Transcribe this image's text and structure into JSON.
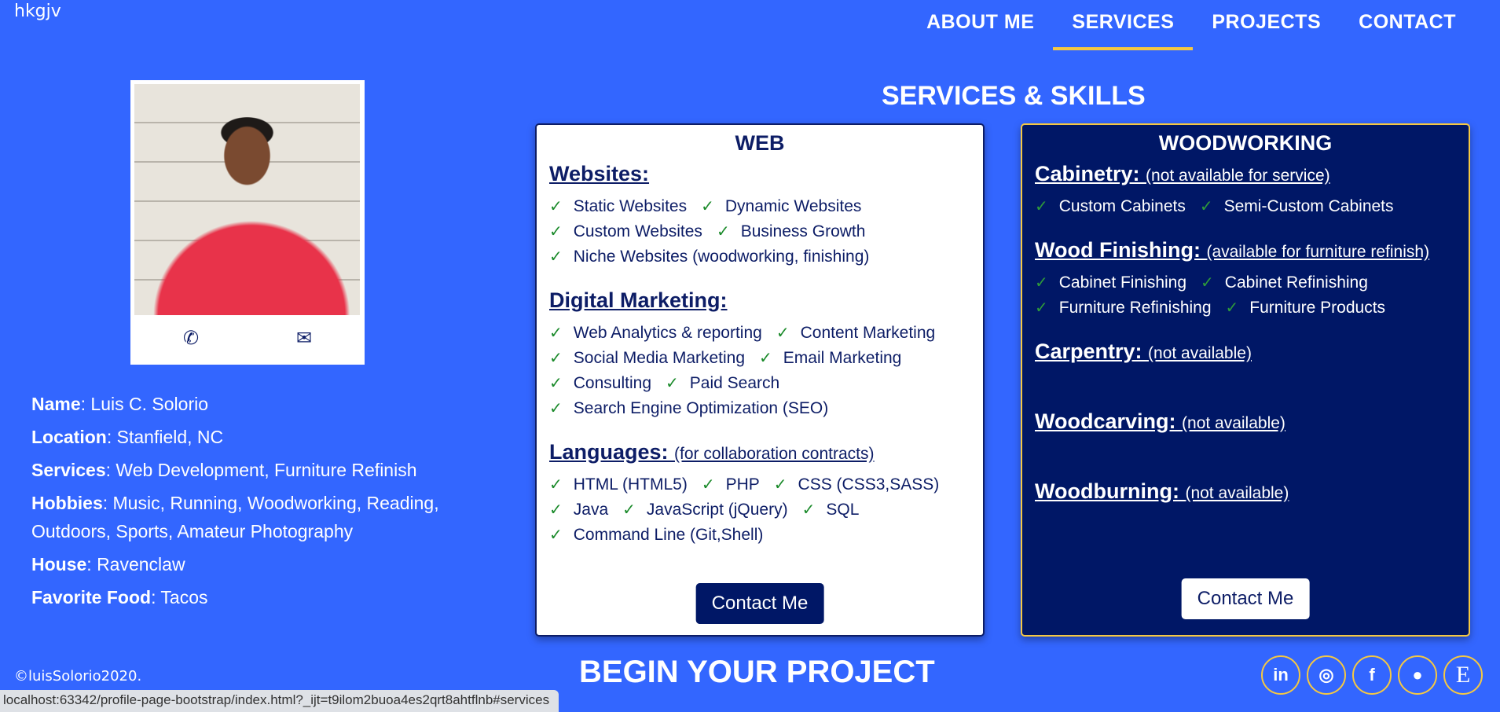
{
  "brand": "hkgjv",
  "nav": [
    {
      "label": "ABOUT ME",
      "active": false
    },
    {
      "label": "SERVICES",
      "active": true
    },
    {
      "label": "PROJECTS",
      "active": false
    },
    {
      "label": "CONTACT",
      "active": false
    }
  ],
  "profile": {
    "photo_alt": "Portrait of Luis C. Solorio",
    "icons": [
      "phone-icon",
      "envelope-icon"
    ],
    "info": [
      {
        "label": "Name",
        "value": ": Luis C. Solorio"
      },
      {
        "label": "Location",
        "value": ": Stanfield, NC"
      },
      {
        "label": "Services",
        "value": ": Web Development, Furniture Refinish"
      },
      {
        "label": "Hobbies",
        "value": ": Music, Running, Woodworking, Reading, Outdoors, Sports, Amateur Photography"
      },
      {
        "label": "House",
        "value": ": Ravenclaw"
      },
      {
        "label": "Favorite Food",
        "value": ": Tacos"
      }
    ]
  },
  "section_title": "SERVICES & SKILLS",
  "web": {
    "title": "WEB",
    "categories": [
      {
        "name": "Websites:",
        "note": "",
        "rows": [
          [
            "Static Websites",
            "Dynamic Websites"
          ],
          [
            "Custom Websites",
            "Business Growth"
          ],
          [
            "Niche Websites (woodworking, finishing)"
          ]
        ]
      },
      {
        "name": "Digital Marketing:",
        "note": "",
        "rows": [
          [
            "Web Analytics & reporting",
            "Content Marketing"
          ],
          [
            "Social Media Marketing",
            "Email Marketing"
          ],
          [
            "Consulting",
            "Paid Search"
          ],
          [
            "Search Engine Optimization (SEO)"
          ]
        ]
      },
      {
        "name": "Languages:",
        "note": "(for collaboration contracts)",
        "rows": [
          [
            "HTML (HTML5)",
            "PHP",
            "CSS (CSS3,SASS)"
          ],
          [
            "Java",
            "JavaScript (jQuery)",
            "SQL"
          ],
          [
            "Command Line (Git,Shell)"
          ]
        ]
      }
    ],
    "button": "Contact Me"
  },
  "wood": {
    "title": "WOODWORKING",
    "categories": [
      {
        "name": "Cabinetry:",
        "note": "(not available for service)",
        "rows": [
          [
            "Custom Cabinets",
            "Semi-Custom Cabinets"
          ]
        ]
      },
      {
        "name": "Wood Finishing:",
        "note": "(available for furniture refinish)",
        "rows": [
          [
            "Cabinet Finishing",
            "Cabinet Refinishing"
          ],
          [
            "Furniture Refinishing",
            "Furniture Products"
          ]
        ]
      },
      {
        "name": "Carpentry:",
        "note": "(not available)",
        "rows": []
      },
      {
        "name": "Woodcarving:",
        "note": "(not available)",
        "rows": []
      },
      {
        "name": "Woodburning:",
        "note": "(not available)",
        "rows": []
      }
    ],
    "button": "Contact Me"
  },
  "footer": {
    "copyright": "©luisSolorio2020.",
    "title": "BEGIN YOUR PROJECT",
    "socials": [
      {
        "name": "linkedin-icon",
        "glyph": "in"
      },
      {
        "name": "instagram-icon",
        "glyph": "◎"
      },
      {
        "name": "facebook-icon",
        "glyph": "f"
      },
      {
        "name": "github-icon",
        "glyph": "●"
      },
      {
        "name": "etsy-icon",
        "glyph": "E"
      }
    ]
  },
  "status_url": "localhost:63342/profile-page-bootstrap/index.html?_ijt=t9ilom2buoa4es2qrt8ahtflnb#services",
  "check_glyph": "✓"
}
